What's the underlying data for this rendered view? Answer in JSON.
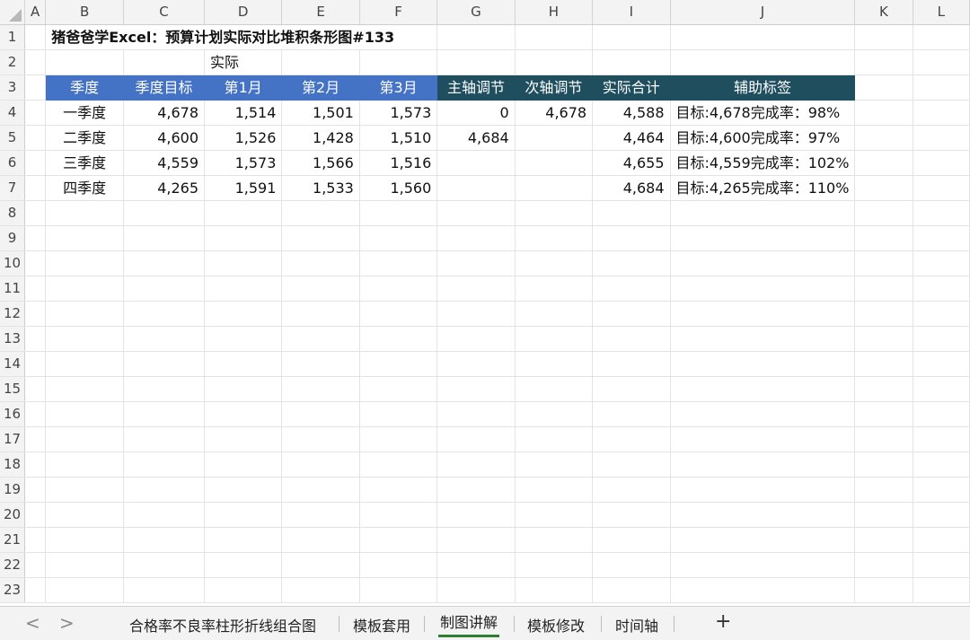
{
  "columns": [
    "A",
    "B",
    "C",
    "D",
    "E",
    "F",
    "G",
    "H",
    "I",
    "J",
    "K",
    "L"
  ],
  "rows": [
    "1",
    "2",
    "3",
    "4",
    "5",
    "6",
    "7",
    "8",
    "9",
    "10",
    "11",
    "12",
    "13",
    "14",
    "15",
    "16",
    "17",
    "18",
    "19",
    "20",
    "21",
    "22",
    "23"
  ],
  "title": "猪爸爸学Excel：预算计划实际对比堆积条形图#133",
  "subheader": "实际",
  "headers": [
    "季度",
    "季度目标",
    "第1月",
    "第2月",
    "第3月",
    "主轴调节",
    "次轴调节",
    "实际合计",
    "辅助标签"
  ],
  "data": [
    [
      "一季度",
      "4,678",
      "1,514",
      "1,501",
      "1,573",
      "0",
      "4,678",
      "4,588",
      "目标:4,678完成率：98%"
    ],
    [
      "二季度",
      "4,600",
      "1,526",
      "1,428",
      "1,510",
      "4,684",
      "",
      "4,464",
      "目标:4,600完成率：97%"
    ],
    [
      "三季度",
      "4,559",
      "1,573",
      "1,566",
      "1,516",
      "",
      "",
      "4,655",
      "目标:4,559完成率：102%"
    ],
    [
      "四季度",
      "4,265",
      "1,591",
      "1,533",
      "1,560",
      "",
      "",
      "4,684",
      "目标:4,265完成率：110%"
    ]
  ],
  "sheet_tabs": [
    "合格率不良率柱形折线组合图",
    "模板套用",
    "制图讲解",
    "模板修改",
    "时间轴"
  ],
  "active_tab": "制图讲解",
  "nav_prev": "<",
  "nav_next": ">",
  "add_sheet": "+",
  "colors": {
    "header_blue": "#4472c4",
    "header_dark": "#1f4e5f",
    "active_tab_underline": "#2e7d32"
  }
}
